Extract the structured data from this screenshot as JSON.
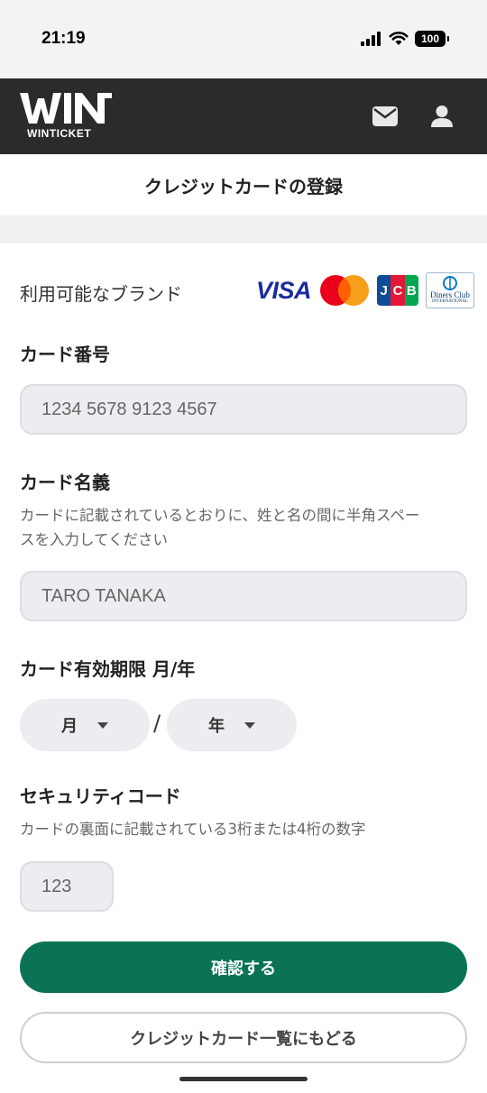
{
  "status_bar": {
    "time": "21:19",
    "battery": "100"
  },
  "header": {
    "logo_text": "WIN",
    "logo_subtext": "WINTICKET"
  },
  "page": {
    "title": "クレジットカードの登録"
  },
  "brands": {
    "label": "利用可能なブランド",
    "visa": "VISA",
    "jcb": "JCB",
    "diners_line1": "Diners Club",
    "diners_line2": "INTERNATIONAL"
  },
  "card_number": {
    "label": "カード番号",
    "placeholder": "1234 5678 9123 4567"
  },
  "card_name": {
    "label": "カード名義",
    "helper_line1": "カードに記載されているとおりに、姓と名の間に半角スペー",
    "helper_line2": "スを入力してください",
    "placeholder": "TARO TANAKA"
  },
  "expiry": {
    "label": "カード有効期限 月/年",
    "month": "月",
    "year": "年",
    "separator": "/"
  },
  "security": {
    "label": "セキュリティコード",
    "helper": "カードの裏面に記載されている3桁または4桁の数字",
    "placeholder": "123"
  },
  "actions": {
    "confirm": "確認する",
    "back_to_list": "クレジットカード一覧にもどる"
  },
  "colors": {
    "primary": "#0a7356",
    "header_bg": "#2b2b2b",
    "field_bg": "#ededf1"
  }
}
